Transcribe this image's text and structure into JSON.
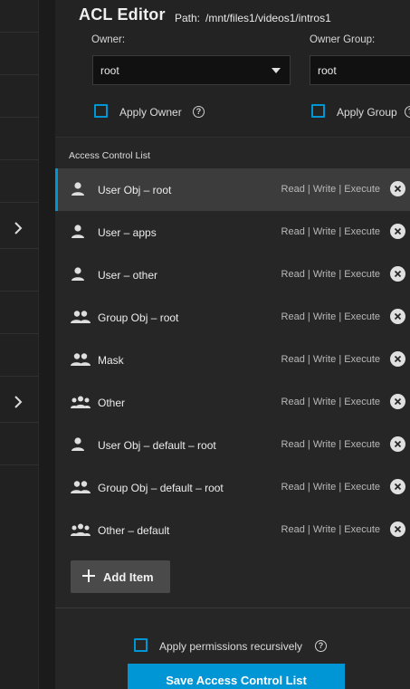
{
  "editor": {
    "title": "ACL Editor",
    "path_prefix": "Path:",
    "path": "/mnt/files1/videos1/intros1"
  },
  "owner": {
    "label": "Owner:",
    "value": "root",
    "apply_label": "Apply Owner",
    "apply_checked": false
  },
  "owner_group": {
    "label": "Owner Group:",
    "value": "root",
    "apply_label": "Apply Group",
    "apply_checked": false
  },
  "acl": {
    "heading": "Access Control List",
    "items": [
      {
        "name": "User Obj – root",
        "perms": "Read | Write | Execute",
        "icon": "user-icon",
        "selected": true
      },
      {
        "name": "User – apps",
        "perms": "Read | Write | Execute",
        "icon": "user-icon",
        "selected": false
      },
      {
        "name": "User – other",
        "perms": "Read | Write | Execute",
        "icon": "user-icon",
        "selected": false
      },
      {
        "name": "Group Obj – root",
        "perms": "Read | Write | Execute",
        "icon": "group-icon",
        "selected": false
      },
      {
        "name": "Mask",
        "perms": "Read | Write | Execute",
        "icon": "group-icon",
        "selected": false
      },
      {
        "name": "Other",
        "perms": "Read | Write | Execute",
        "icon": "everyone-icon",
        "selected": false
      },
      {
        "name": "User Obj – default – root",
        "perms": "Read | Write | Execute",
        "icon": "user-icon",
        "selected": false
      },
      {
        "name": "Group Obj – default – root",
        "perms": "Read | Write | Execute",
        "icon": "group-icon",
        "selected": false
      },
      {
        "name": "Other – default",
        "perms": "Read | Write | Execute",
        "icon": "everyone-icon",
        "selected": false
      }
    ],
    "add_label": "Add Item"
  },
  "footer": {
    "recursive_label": "Apply permissions recursively",
    "recursive_checked": false,
    "save_label": "Save Access Control List"
  },
  "colors": {
    "accent": "#0095d5",
    "background": "#1b1b1b",
    "panel": "#262626"
  }
}
